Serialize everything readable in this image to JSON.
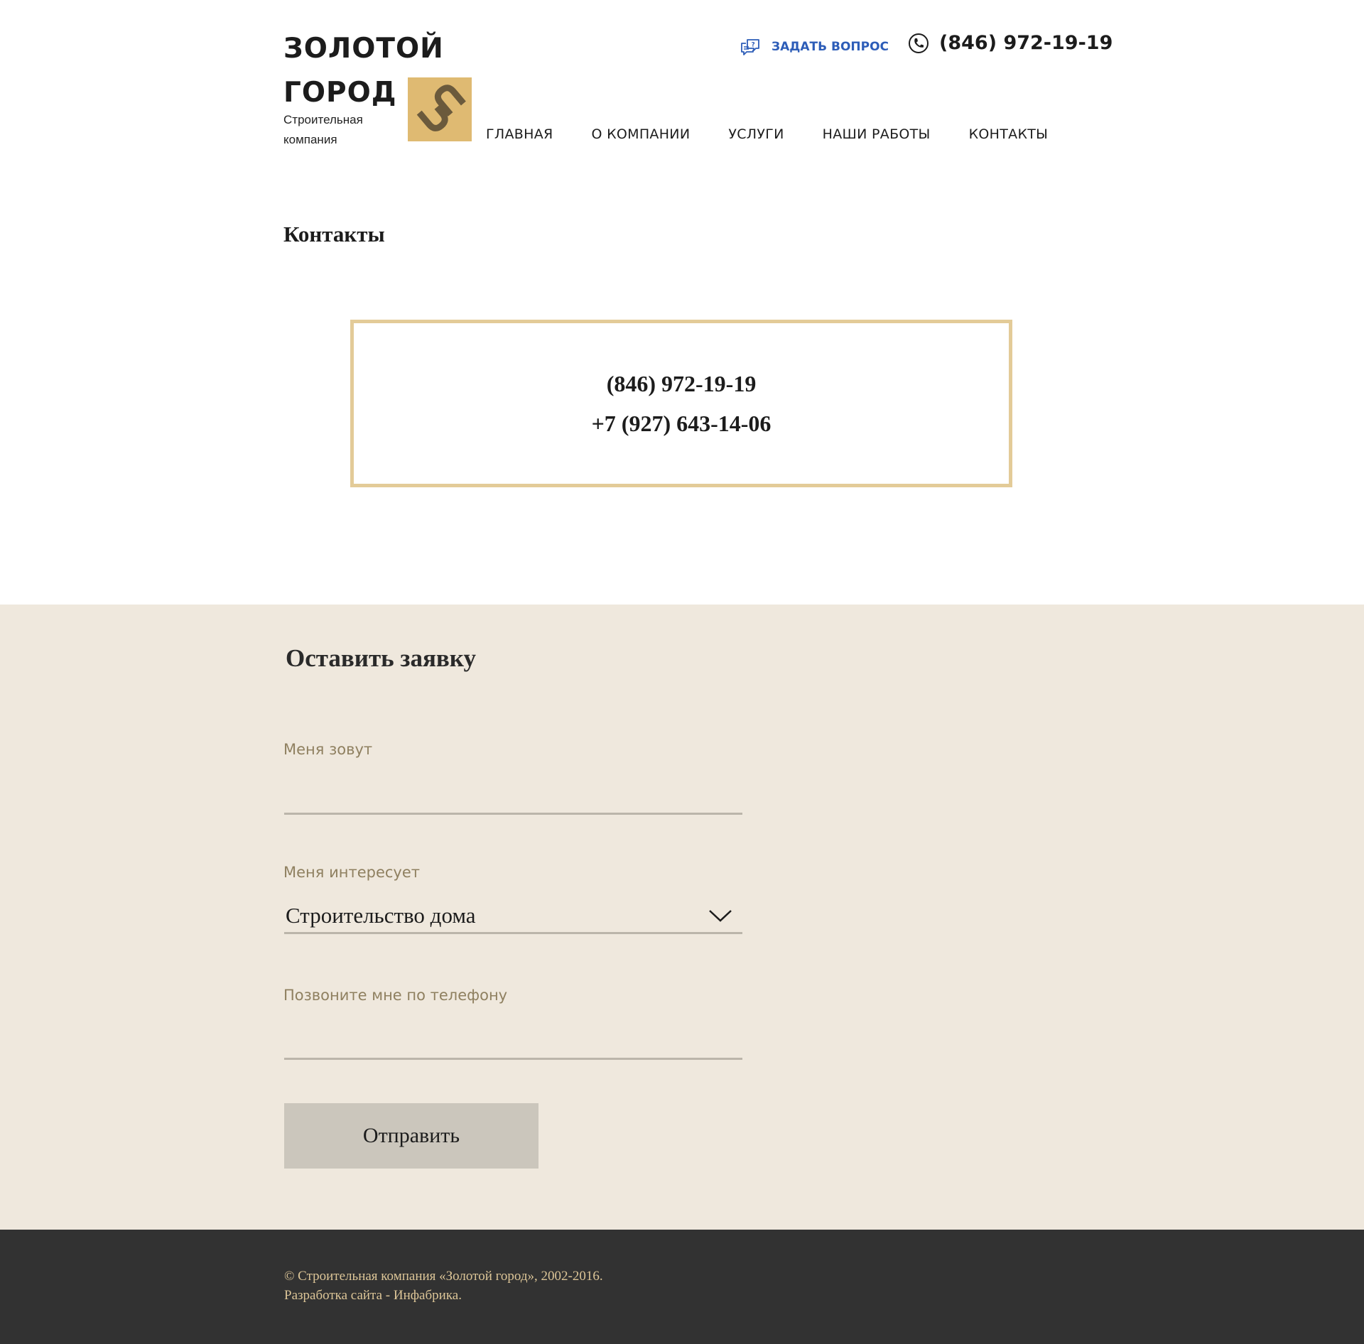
{
  "header": {
    "brand_line1": "ЗОЛОТОЙ",
    "brand_line2": "ГОРОД",
    "brand_sub_line1": "Строительная",
    "brand_sub_line2": "компания",
    "ask_label": "ЗАДАТЬ ВОПРОС",
    "phone": "(846) 972-19-19",
    "logo_color": "#dfba72",
    "link_color": "#2d5db8"
  },
  "nav": {
    "items": [
      {
        "label": "ГЛАВНАЯ"
      },
      {
        "label": "О КОМПАНИИ"
      },
      {
        "label": "УСЛУГИ"
      },
      {
        "label": "НАШИ РАБОТЫ"
      },
      {
        "label": "КОНТАКТЫ"
      }
    ]
  },
  "contacts": {
    "title": "Контакты",
    "phones": [
      "(846) 972-19-19",
      "+7 (927) 643-14-06"
    ]
  },
  "request": {
    "title": "Оставить заявку",
    "name_label": "Меня зовут",
    "name_value": "",
    "interest_label": "Меня интересует",
    "interest_value": "Строительство дома",
    "phone_label": "Позвоните мне по телефону",
    "phone_value": "",
    "submit_label": "Отправить",
    "background": "#efe8dd"
  },
  "footer": {
    "line1": "© Строительная компания «Золотой город», 2002-2016.",
    "line2": "Разработка сайта - Инфабрика."
  }
}
